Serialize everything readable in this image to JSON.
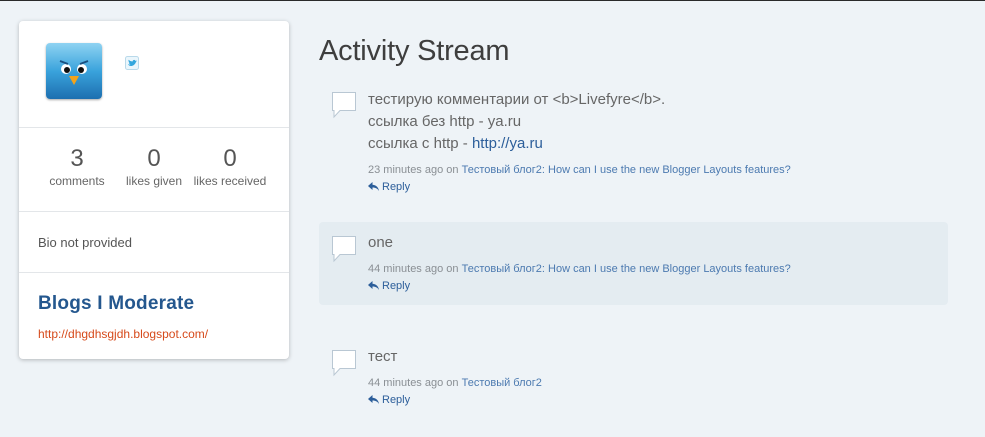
{
  "profile": {
    "stats": [
      {
        "value": "3",
        "label": "comments"
      },
      {
        "value": "0",
        "label": "likes given"
      },
      {
        "value": "0",
        "label": "likes received"
      }
    ],
    "bio": "Bio not provided",
    "blogs_title": "Blogs I Moderate",
    "blog_link": "http://dhgdhsgjdh.blogspot.com/"
  },
  "main": {
    "title": "Activity Stream",
    "entries": [
      {
        "line1": "тестирую комментарии от <b>Livefyre</b>.",
        "line2": "ссылка без http - ya.ru",
        "line3_prefix": "ссылка с http - ",
        "line3_link": "http://ya.ru",
        "time": "23 minutes ago",
        "on": "on",
        "target": "Тестовый блог2: How can I use the new Blogger Layouts features?",
        "reply": "Reply"
      },
      {
        "line1": "one",
        "time": "44 minutes ago",
        "on": "on",
        "target": "Тестовый блог2: How can I use the new Blogger Layouts features?",
        "reply": "Reply"
      },
      {
        "line1": "тест",
        "time": "44 minutes ago",
        "on": "on",
        "target": "Тестовый блог2",
        "reply": "Reply"
      }
    ]
  },
  "colors": {
    "accent": "#24578e",
    "link_orange": "#d64a1b",
    "highlight_row": "#e4ecf1"
  },
  "icons": [
    "tweety-avatar",
    "twitter-icon",
    "comment-bubble-icon",
    "reply-arrow-icon"
  ]
}
